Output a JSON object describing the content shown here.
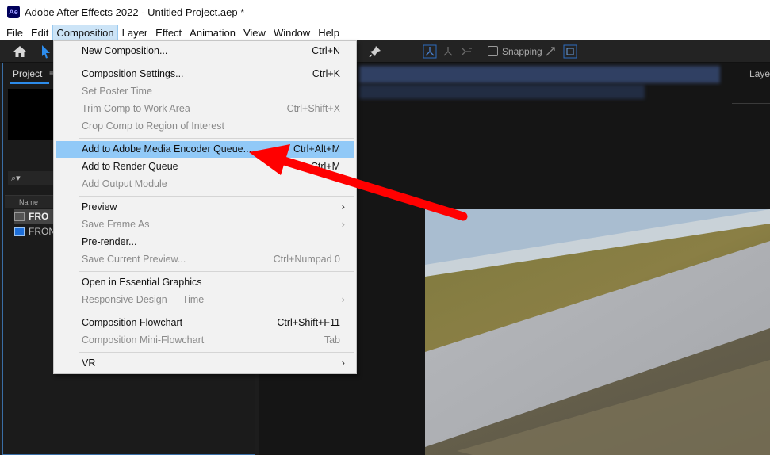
{
  "window": {
    "title": "Adobe After Effects 2022 - Untitled Project.aep *",
    "logo_text": "Ae"
  },
  "menubar": {
    "items": [
      "File",
      "Edit",
      "Composition",
      "Layer",
      "Effect",
      "Animation",
      "View",
      "Window",
      "Help"
    ],
    "active": "Composition"
  },
  "toolbar": {
    "snapping_label": "Snapping"
  },
  "project_panel": {
    "tab_label": "Project",
    "menu_glyph": "≡",
    "search_glyph": "⌕▾",
    "column_name": "Name",
    "rows": [
      "FRO",
      "FRON"
    ]
  },
  "timeline": {
    "layer_label": "Layer"
  },
  "composition_menu": {
    "items": [
      {
        "label": "New Composition...",
        "shortcut": "Ctrl+N",
        "enabled": true
      },
      {
        "label": "Composition Settings...",
        "shortcut": "Ctrl+K",
        "enabled": true
      },
      {
        "label": "Set Poster Time",
        "shortcut": "",
        "enabled": false
      },
      {
        "label": "Trim Comp to Work Area",
        "shortcut": "Ctrl+Shift+X",
        "enabled": false
      },
      {
        "label": "Crop Comp to Region of Interest",
        "shortcut": "",
        "enabled": false
      },
      {
        "label": "Add to Adobe Media Encoder Queue...",
        "shortcut": "Ctrl+Alt+M",
        "enabled": true,
        "highlighted": true
      },
      {
        "label": "Add to Render Queue",
        "shortcut": "Ctrl+M",
        "enabled": true
      },
      {
        "label": "Add Output Module",
        "shortcut": "",
        "enabled": false
      },
      {
        "label": "Preview",
        "shortcut": "",
        "enabled": true,
        "submenu": true
      },
      {
        "label": "Save Frame As",
        "shortcut": "",
        "enabled": false,
        "submenu": true
      },
      {
        "label": "Pre-render...",
        "shortcut": "",
        "enabled": true
      },
      {
        "label": "Save Current Preview...",
        "shortcut": "Ctrl+Numpad 0",
        "enabled": false
      },
      {
        "label": "Open in Essential Graphics",
        "shortcut": "",
        "enabled": true
      },
      {
        "label": "Responsive Design — Time",
        "shortcut": "",
        "enabled": false,
        "submenu": true
      },
      {
        "label": "Composition Flowchart",
        "shortcut": "Ctrl+Shift+F11",
        "enabled": true
      },
      {
        "label": "Composition Mini-Flowchart",
        "shortcut": "Tab",
        "enabled": false
      },
      {
        "label": "VR",
        "shortcut": "",
        "enabled": true,
        "submenu": true
      }
    ],
    "submenu_glyph": "›"
  },
  "colors": {
    "highlight": "#91c9f7",
    "accent_blue": "#2d8ceb",
    "annotation_arrow": "#ff0000"
  }
}
